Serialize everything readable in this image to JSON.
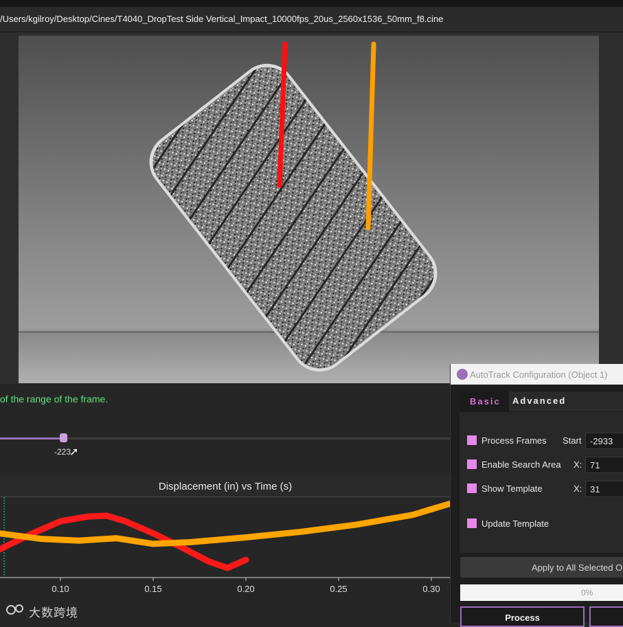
{
  "file_path": "/Users/kgilroy/Desktop/Cines/T4040_DropTest Side Vertical_Impact_10000fps_20us_2560x1536_50mm_f8.cine",
  "info_message": "of the range of the frame.",
  "slider": {
    "value_label": "-223",
    "fill_fraction": 0.14
  },
  "chart": {
    "title": "Displacement (in) vs Time (s)",
    "x_ticks": [
      "0.10",
      "0.15",
      "0.20",
      "0.25",
      "0.30"
    ]
  },
  "chart_data": {
    "type": "line",
    "title": "Displacement (in) vs Time (s)",
    "x_ticks": [
      0.1,
      0.15,
      0.2,
      0.25,
      0.3
    ],
    "series": [
      {
        "color": "#ff1a1a",
        "x": [
          0.067,
          0.085,
          0.1,
          0.115,
          0.125,
          0.135,
          0.15,
          0.165,
          0.18,
          0.19,
          0.2
        ],
        "y": [
          0.35,
          0.55,
          0.7,
          0.76,
          0.77,
          0.7,
          0.55,
          0.38,
          0.2,
          0.12,
          0.22
        ]
      },
      {
        "color": "#ffa500",
        "x": [
          0.067,
          0.09,
          0.11,
          0.13,
          0.15,
          0.17,
          0.2,
          0.23,
          0.26,
          0.29,
          0.31
        ],
        "y": [
          0.55,
          0.48,
          0.46,
          0.49,
          0.42,
          0.44,
          0.5,
          0.57,
          0.66,
          0.78,
          0.92
        ]
      }
    ]
  },
  "panel": {
    "title": "AutoTrack Configuration (Object 1)",
    "tabs": {
      "basic": "Basic",
      "advanced": "Advanced"
    },
    "process_frames": {
      "label": "Process Frames",
      "start_label": "Start",
      "start_value": "-2933"
    },
    "search_area": {
      "label": "Enable Search Area",
      "x_label": "X:",
      "x_value": "71"
    },
    "show_template": {
      "label": "Show Template",
      "x_label": "X:",
      "x_value": "31"
    },
    "update_template": {
      "label": "Update Template"
    },
    "apply_label": "Apply to All Selected Ob",
    "progress_label": "0%",
    "process_label": "Process"
  },
  "watermark": "大数跨境",
  "colors": {
    "accent": "#a06cc0",
    "checkbox": "#e589e8",
    "info_text": "#5ee37b",
    "track_red": "#ff1a1a",
    "track_orange": "#ffa500"
  }
}
